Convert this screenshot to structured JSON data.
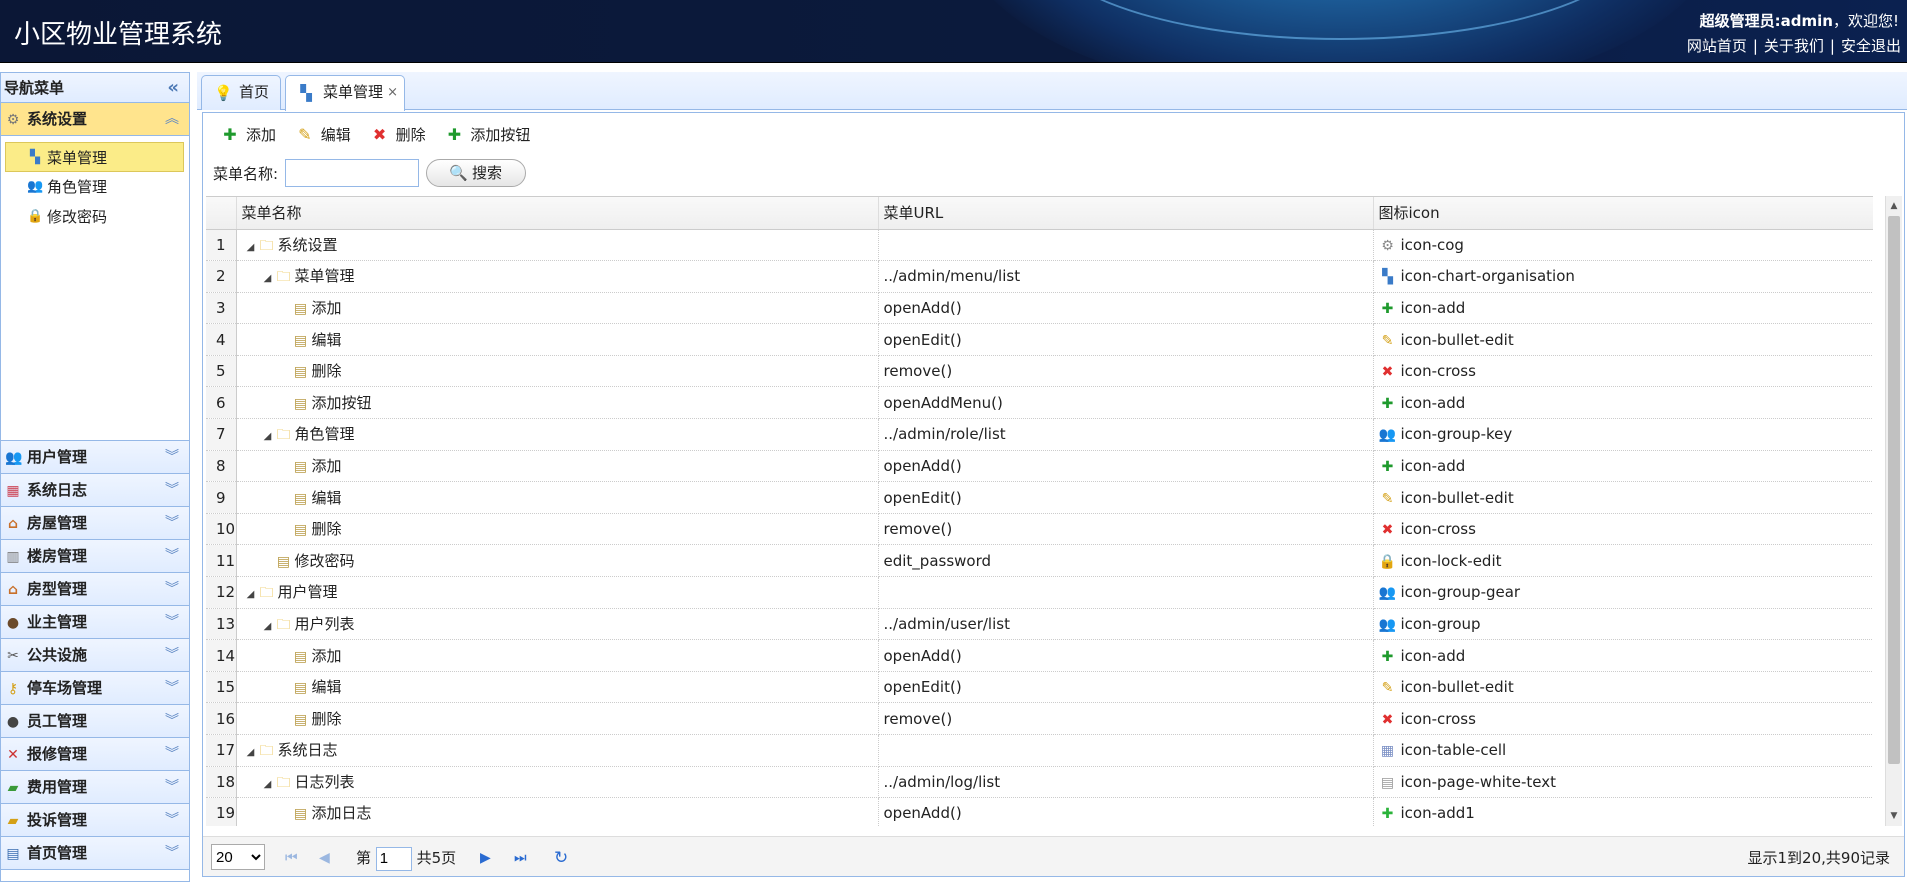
{
  "header": {
    "title": "小区物业管理系统",
    "user": "超级管理员:admin",
    "greeting": "，欢迎您!",
    "links": [
      "网站首页",
      "关于我们",
      "安全退出"
    ]
  },
  "sidebar": {
    "title": "导航菜单",
    "expanded": {
      "label": "系统设置",
      "items": [
        {
          "label": "菜单管理",
          "icon": "chart-organisation-icon",
          "selected": true
        },
        {
          "label": "角色管理",
          "icon": "group-key-icon"
        },
        {
          "label": "修改密码",
          "icon": "lock-edit-icon"
        }
      ]
    },
    "groups": [
      {
        "label": "用户管理",
        "icon": "group-icon"
      },
      {
        "label": "系统日志",
        "icon": "table-cell-icon"
      },
      {
        "label": "房屋管理",
        "icon": "house-icon"
      },
      {
        "label": "楼房管理",
        "icon": "building-icon"
      },
      {
        "label": "房型管理",
        "icon": "house-icon"
      },
      {
        "label": "业主管理",
        "icon": "user-icon"
      },
      {
        "label": "公共设施",
        "icon": "tools-icon"
      },
      {
        "label": "停车场管理",
        "icon": "key-icon"
      },
      {
        "label": "员工管理",
        "icon": "user-suit-icon"
      },
      {
        "label": "报修管理",
        "icon": "wrench-icon"
      },
      {
        "label": "费用管理",
        "icon": "money-icon"
      },
      {
        "label": "投诉管理",
        "icon": "folder-edit-icon"
      },
      {
        "label": "首页管理",
        "icon": "application-icon"
      }
    ]
  },
  "tabs": [
    {
      "label": "首页",
      "icon": "lightbulb-icon",
      "active": false
    },
    {
      "label": "菜单管理",
      "icon": "chart-organisation-icon",
      "active": true,
      "closable": true
    }
  ],
  "toolbar": {
    "add": "添加",
    "edit": "编辑",
    "delete": "删除",
    "add_button": "添加按钮"
  },
  "search": {
    "label": "菜单名称:",
    "value": "",
    "button": "搜索"
  },
  "grid": {
    "columns": [
      "菜单名称",
      "菜单URL",
      "图标icon"
    ],
    "rows": [
      {
        "n": "1",
        "level": 0,
        "type": "folder",
        "open": true,
        "name": "系统设置",
        "url": "",
        "icon": "icon-cog"
      },
      {
        "n": "2",
        "level": 1,
        "type": "folder",
        "open": true,
        "name": "菜单管理",
        "url": "../admin/menu/list",
        "icon": "icon-chart-organisation"
      },
      {
        "n": "3",
        "level": 2,
        "type": "file",
        "name": "添加",
        "url": "openAdd()",
        "icon": "icon-add"
      },
      {
        "n": "4",
        "level": 2,
        "type": "file",
        "name": "编辑",
        "url": "openEdit()",
        "icon": "icon-bullet-edit"
      },
      {
        "n": "5",
        "level": 2,
        "type": "file",
        "name": "删除",
        "url": "remove()",
        "icon": "icon-cross"
      },
      {
        "n": "6",
        "level": 2,
        "type": "file",
        "name": "添加按钮",
        "url": "openAddMenu()",
        "icon": "icon-add"
      },
      {
        "n": "7",
        "level": 1,
        "type": "folder",
        "open": true,
        "name": "角色管理",
        "url": "../admin/role/list",
        "icon": "icon-group-key"
      },
      {
        "n": "8",
        "level": 2,
        "type": "file",
        "name": "添加",
        "url": "openAdd()",
        "icon": "icon-add"
      },
      {
        "n": "9",
        "level": 2,
        "type": "file",
        "name": "编辑",
        "url": "openEdit()",
        "icon": "icon-bullet-edit"
      },
      {
        "n": "10",
        "level": 2,
        "type": "file",
        "name": "删除",
        "url": "remove()",
        "icon": "icon-cross"
      },
      {
        "n": "11",
        "level": 1,
        "type": "file",
        "name": "修改密码",
        "url": "edit_password",
        "icon": "icon-lock-edit"
      },
      {
        "n": "12",
        "level": 0,
        "type": "folder",
        "open": true,
        "name": "用户管理",
        "url": "",
        "icon": "icon-group-gear"
      },
      {
        "n": "13",
        "level": 1,
        "type": "folder",
        "open": true,
        "name": "用户列表",
        "url": "../admin/user/list",
        "icon": "icon-group"
      },
      {
        "n": "14",
        "level": 2,
        "type": "file",
        "name": "添加",
        "url": "openAdd()",
        "icon": "icon-add"
      },
      {
        "n": "15",
        "level": 2,
        "type": "file",
        "name": "编辑",
        "url": "openEdit()",
        "icon": "icon-bullet-edit"
      },
      {
        "n": "16",
        "level": 2,
        "type": "file",
        "name": "删除",
        "url": "remove()",
        "icon": "icon-cross"
      },
      {
        "n": "17",
        "level": 0,
        "type": "folder",
        "open": true,
        "name": "系统日志",
        "url": "",
        "icon": "icon-table-cell"
      },
      {
        "n": "18",
        "level": 1,
        "type": "folder",
        "open": true,
        "name": "日志列表",
        "url": "../admin/log/list",
        "icon": "icon-page-white-text"
      },
      {
        "n": "19",
        "level": 2,
        "type": "file",
        "name": "添加日志",
        "url": "openAdd()",
        "icon": "icon-add1"
      }
    ]
  },
  "pager": {
    "page_size": "20",
    "page_prefix": "第",
    "page": "1",
    "page_suffix": "共5页",
    "info": "显示1到20,共90记录"
  },
  "colors": {
    "header_bg": "#0b1736",
    "panel_border": "#95b8e7",
    "selected_bg": "#ffe48d"
  }
}
